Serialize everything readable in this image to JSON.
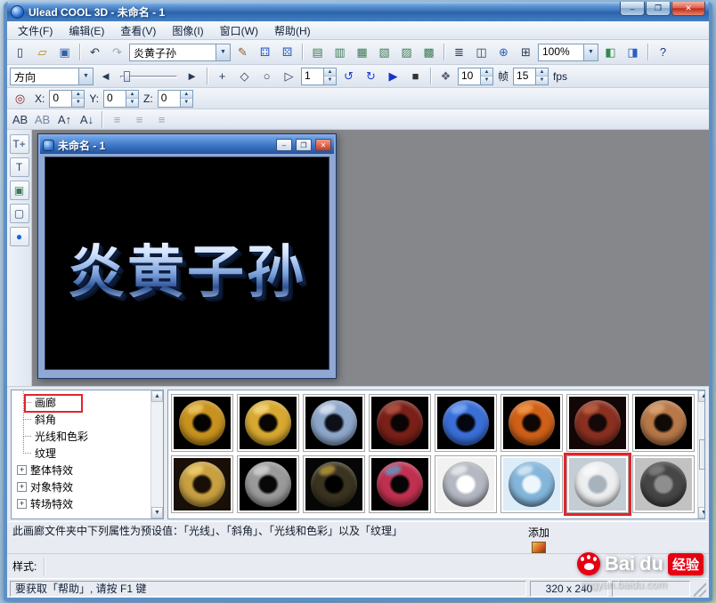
{
  "window": {
    "title": "Ulead COOL 3D - 未命名 - 1"
  },
  "menu": {
    "items": [
      {
        "id": "file",
        "label": "文件(F)"
      },
      {
        "id": "edit",
        "label": "编辑(E)"
      },
      {
        "id": "view",
        "label": "查看(V)"
      },
      {
        "id": "image",
        "label": "图像(I)"
      },
      {
        "id": "window",
        "label": "窗口(W)"
      },
      {
        "id": "help",
        "label": "帮助(H)"
      }
    ]
  },
  "combos": {
    "preset": {
      "value": "炎黄子孙"
    },
    "zoom": {
      "value": "100%"
    },
    "direction": {
      "value": "方向"
    }
  },
  "anim": {
    "frame_value": "1",
    "total_value": "10",
    "frame_label": "帧",
    "fps_value": "15",
    "fps_label": "fps"
  },
  "position": {
    "x_label": "X:",
    "x_value": "0",
    "y_label": "Y:",
    "y_value": "0",
    "z_label": "Z:",
    "z_value": "0"
  },
  "toolbars": {
    "std_left": [
      {
        "name": "new-document-icon",
        "glyph": "▯"
      },
      {
        "name": "open-file-icon",
        "glyph": "▱",
        "color": "#b8860b"
      },
      {
        "name": "save-icon",
        "glyph": "▣",
        "color": "#2f5fae"
      },
      {
        "sep": true
      },
      {
        "name": "undo-icon",
        "glyph": "↶"
      },
      {
        "name": "redo-icon",
        "glyph": "↷",
        "disabled": true
      }
    ],
    "std_mid": [
      {
        "name": "text-edit-icon",
        "glyph": "✎",
        "color": "#8a5a20"
      },
      {
        "name": "dice-icon-1",
        "glyph": "⚃",
        "color": "#2a5fc0"
      },
      {
        "name": "dice-icon-2",
        "glyph": "⚄",
        "color": "#2a5fc0"
      },
      {
        "sep": true
      },
      {
        "name": "window-layout-icon-1",
        "glyph": "▤",
        "color": "#3d7a55"
      },
      {
        "name": "window-layout-icon-2",
        "glyph": "▥",
        "color": "#3d7a55"
      },
      {
        "name": "window-layout-icon-3",
        "glyph": "▦",
        "color": "#3d7a55"
      },
      {
        "name": "window-layout-icon-4",
        "glyph": "▧",
        "color": "#3d7a55"
      },
      {
        "name": "window-layout-icon-5",
        "glyph": "▨",
        "color": "#3d7a55"
      },
      {
        "name": "window-layout-icon-6",
        "glyph": "▩",
        "color": "#3d7a55"
      },
      {
        "sep": true
      },
      {
        "name": "object-manager-icon",
        "glyph": "≣"
      },
      {
        "name": "fit-window-icon",
        "glyph": "◫"
      },
      {
        "name": "web-icon",
        "glyph": "⊕",
        "color": "#2a5fc0"
      },
      {
        "name": "grid-icon",
        "glyph": "⊞"
      }
    ],
    "std_right": [
      {
        "name": "render-quality-icon",
        "glyph": "◧",
        "color": "#2f8a4a"
      },
      {
        "name": "preview-icon",
        "glyph": "◨",
        "color": "#2a5fc0"
      },
      {
        "sep": true
      },
      {
        "name": "context-help-icon",
        "glyph": "?",
        "color": "#1a3a7a"
      }
    ],
    "anim_nav_left": [
      {
        "name": "prev-keyframe-icon",
        "glyph": "◄"
      }
    ],
    "anim_nav_right": [
      {
        "name": "next-keyframe-icon",
        "glyph": "►"
      }
    ],
    "transform": [
      {
        "sep": true
      },
      {
        "name": "move-object-icon",
        "glyph": "+"
      },
      {
        "name": "scale-object-icon",
        "glyph": "◇"
      },
      {
        "name": "rotate-object-icon",
        "glyph": "○"
      },
      {
        "name": "play-direction-icon",
        "glyph": "▷"
      }
    ],
    "rotate": [
      {
        "name": "loop-back-icon",
        "glyph": "↺",
        "color": "#1a3fd0"
      },
      {
        "name": "loop-forward-icon",
        "glyph": "↻",
        "color": "#1a3fd0"
      }
    ],
    "playback": [
      {
        "name": "play-icon",
        "glyph": "▶",
        "color": "#1535c8"
      },
      {
        "name": "stop-icon",
        "glyph": "■",
        "color": "#333333"
      },
      {
        "sep": true
      },
      {
        "name": "export-animation-icon",
        "glyph": "❖",
        "color": "#556070"
      }
    ],
    "pos_mode": [
      {
        "name": "coordinate-mode-icon",
        "glyph": "◎",
        "color": "#8a2020"
      }
    ],
    "text_tools": [
      {
        "name": "insert-text-icon",
        "glyph": "AB"
      },
      {
        "name": "edit-text-char-icon",
        "glyph": "AB",
        "color": "#778699"
      },
      {
        "name": "kerning-up-icon",
        "glyph": "A↑"
      },
      {
        "name": "kerning-down-icon",
        "glyph": "A↓"
      },
      {
        "sep": true
      },
      {
        "name": "align-left-icon",
        "glyph": "≡",
        "disabled": true
      },
      {
        "name": "align-center-icon",
        "glyph": "≡",
        "disabled": true
      },
      {
        "name": "align-right-icon",
        "glyph": "≡",
        "disabled": true
      }
    ],
    "left_tools": [
      {
        "name": "insert-text-tool-icon",
        "glyph": "T+"
      },
      {
        "name": "edit-text-tool-icon",
        "glyph": "T"
      },
      {
        "name": "insert-image-tool-icon",
        "glyph": "▣",
        "color": "#3a7a55"
      },
      {
        "name": "selection-tool-icon",
        "glyph": "▢"
      },
      {
        "name": "sphere-tool-icon",
        "glyph": "●",
        "color": "#1c66d8"
      }
    ]
  },
  "child_window": {
    "title": "未命名 - 1",
    "canvas_text": "炎黄子孙",
    "buttons": {
      "minimize": "–",
      "restore": "❐",
      "close": "✕"
    }
  },
  "titlebar_buttons": {
    "minimize": "–",
    "maximize": "❐",
    "close": "✕"
  },
  "tree": {
    "items": [
      {
        "id": "gallery",
        "label": "画廊",
        "leaf": true,
        "annotated": true
      },
      {
        "id": "bevel",
        "label": "斜角",
        "leaf": true
      },
      {
        "id": "light-color",
        "label": "光线和色彩",
        "leaf": true
      },
      {
        "id": "texture",
        "label": "纹理",
        "leaf": true
      },
      {
        "id": "global-effects",
        "label": "整体特效",
        "expandable": true
      },
      {
        "id": "object-effects",
        "label": "对象特效",
        "expandable": true
      },
      {
        "id": "transition-effects",
        "label": "转场特效",
        "expandable": true
      }
    ]
  },
  "gallery": {
    "add_label": "添加",
    "items": [
      {
        "name": "gold-ring",
        "bg": "#000000",
        "ring": "#c8921e",
        "hole": "#050302",
        "hi": "#f8dc82"
      },
      {
        "name": "brass-ring",
        "bg": "#000000",
        "ring": "#d8a830",
        "hole": "#080502",
        "hi": "#ffe9a0"
      },
      {
        "name": "chrome-blue-ring",
        "bg": "#000000",
        "ring": "#8ea8cc",
        "hole": "#0e1018",
        "hi": "#ffffff"
      },
      {
        "name": "maroon-ring",
        "bg": "#000000",
        "ring": "#7a2018",
        "hole": "#0a0504",
        "hi": "#c86b58"
      },
      {
        "name": "blue-texture-ring",
        "bg": "#000000",
        "ring": "#3a6fd8",
        "hole": "#04070f",
        "hi": "#9cc4ff"
      },
      {
        "name": "orange-ribbed-ring",
        "bg": "#000000",
        "ring": "#d06018",
        "hole": "#0f0703",
        "hi": "#ffb060"
      },
      {
        "name": "dark-red-carved-ring",
        "bg": "#120606",
        "ring": "#8a3020",
        "hole": "#140808",
        "hi": "#d07850"
      },
      {
        "name": "copper-ring",
        "bg": "#000000",
        "ring": "#b87848",
        "hole": "#0f0a05",
        "hi": "#e8b888"
      },
      {
        "name": "gold-beaded-ring",
        "bg": "#181008",
        "ring": "#c8a040",
        "hole": "#181008",
        "hi": "#ffe080"
      },
      {
        "name": "steel-holes-ring",
        "bg": "#000000",
        "ring": "#9a9a9a",
        "hole": "#080808",
        "hi": "#e8e8e8"
      },
      {
        "name": "black-gold-spots-ring",
        "bg": "#060606",
        "ring": "#3a3320",
        "hole": "#000000",
        "hi": "#e8c040"
      },
      {
        "name": "rainbow-mosaic-ring",
        "bg": "#000000",
        "ring": "#c03050",
        "hole": "#050505",
        "hi": "#40c0f0"
      },
      {
        "name": "silver-ring",
        "bg": "#f2f2f2",
        "ring": "#b4b8c2",
        "hole": "#ffffff",
        "hi": "#ffffff"
      },
      {
        "name": "light-blue-ring",
        "bg": "#dcecf8",
        "ring": "#84b6dc",
        "hole": "#eef6fc",
        "hi": "#ffffff"
      },
      {
        "name": "white-ring",
        "bg": "#c4ccd4",
        "ring": "#eceef0",
        "hole": "#a8b2bc",
        "hi": "#ffffff",
        "selected": true
      },
      {
        "name": "bolted-steel-ring",
        "bg": "#c2c2c2",
        "ring": "#464646",
        "hole": "#8e8e8e",
        "hi": "#9a9a9a"
      }
    ]
  },
  "panels": {
    "description": "此画廊文件夹中下列属性为预设值：「光线」、「斜角」、「光线和色彩」以及「纹理」"
  },
  "style_row": {
    "label": "样式:"
  },
  "statusbar": {
    "help_text": "要获取「帮助」, 请按 F1 键",
    "size_text": "320 x 240"
  },
  "watermark": {
    "bai": "Bai",
    "du": "du",
    "tag": "经验",
    "url": "jingyan.baidu.com"
  }
}
